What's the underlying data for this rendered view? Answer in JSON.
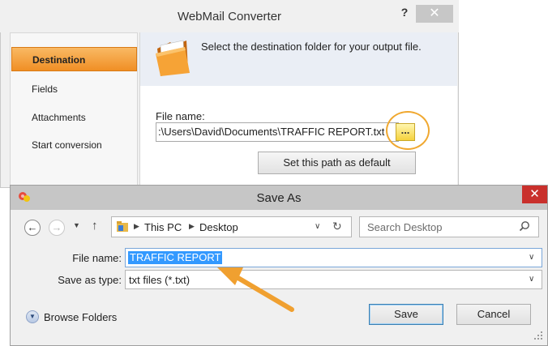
{
  "converter": {
    "title": "WebMail Converter",
    "help_label": "?",
    "close_label": "✕",
    "sidebar": {
      "items": [
        {
          "label": "Destination",
          "active": true
        },
        {
          "label": "Fields",
          "active": false
        },
        {
          "label": "Attachments",
          "active": false
        },
        {
          "label": "Start conversion",
          "active": false
        }
      ]
    },
    "heading": "Select the destination folder for your output file.",
    "file_name_label": "File name:",
    "file_path_value": ":\\Users\\David\\Documents\\TRAFFIC REPORT.txt",
    "browse_label": "...",
    "set_default_label": "Set this path as default"
  },
  "save_as": {
    "title": "Save As",
    "close_label": "✕",
    "nav": {
      "back_label": "←",
      "forward_label": "→",
      "recent_label": "▼",
      "up_label": "↑"
    },
    "breadcrumb": [
      "This PC",
      "Desktop"
    ],
    "crumb_separator": "▶",
    "address_dropdown": "∨",
    "refresh_label": "↻",
    "search_placeholder": "Search Desktop",
    "file_name_label": "File name:",
    "file_name_value": "TRAFFIC REPORT",
    "save_as_type_label": "Save as type:",
    "save_as_type_value": "txt files (*.txt)",
    "dropdown_glyph": "∨",
    "browse_folders_label": "Browse Folders",
    "browse_folders_glyph": "▼",
    "save_label": "Save",
    "cancel_label": "Cancel"
  },
  "colors": {
    "active_nav": "#f08f25",
    "highlight_ring": "#f0a830",
    "annotation_arrow": "#f0a030",
    "selection": "#3399ff",
    "close_red": "#c9302c"
  }
}
